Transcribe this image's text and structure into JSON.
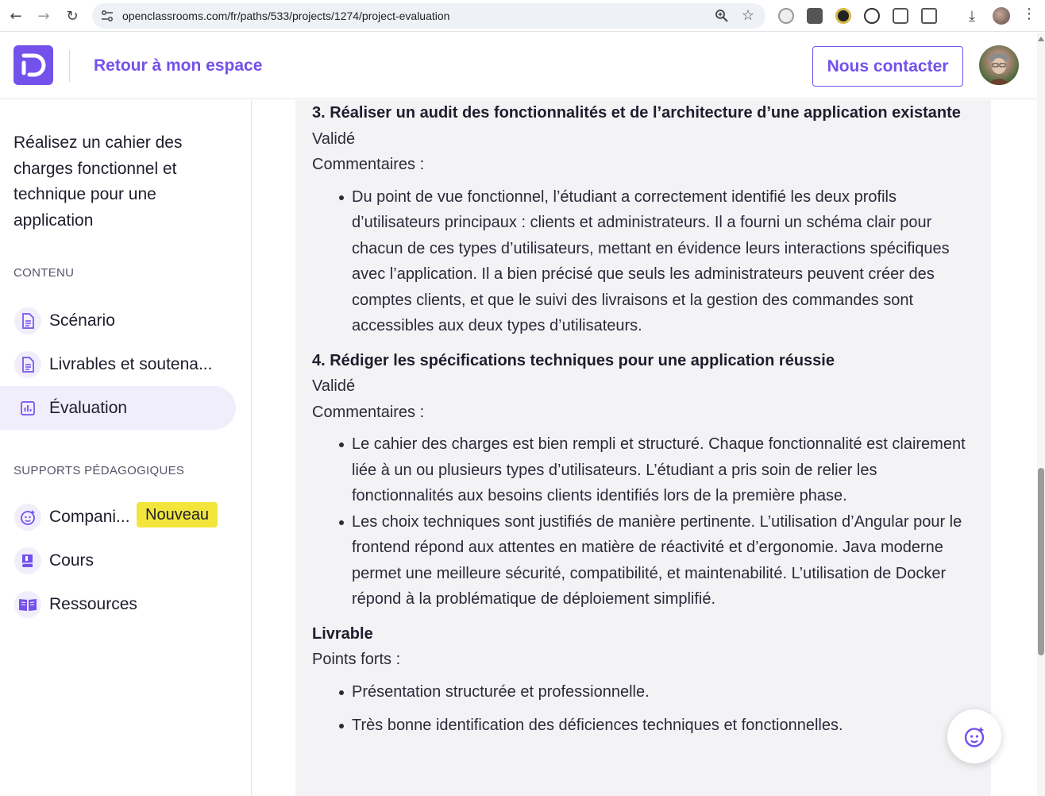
{
  "browser": {
    "url": "openclassrooms.com/fr/paths/533/projects/1274/project-evaluation"
  },
  "header": {
    "back_label": "Retour à mon espace",
    "contact_label": "Nous contacter"
  },
  "sidebar": {
    "title": "Réalisez un cahier des charges fonctionnel et technique pour une application",
    "content_heading": "CONTENU",
    "content_items": [
      {
        "label": "Scénario",
        "icon": "document-icon"
      },
      {
        "label": "Livrables et soutena...",
        "icon": "document-icon"
      },
      {
        "label": "Évaluation",
        "icon": "chart-icon",
        "active": true
      }
    ],
    "supports_heading": "SUPPORTS PÉDAGOGIQUES",
    "support_items": [
      {
        "label": "Compani...",
        "icon": "companion-icon",
        "badge": "Nouveau"
      },
      {
        "label": "Cours",
        "icon": "book-icon"
      },
      {
        "label": "Ressources",
        "icon": "open-book-icon"
      }
    ]
  },
  "evaluation": {
    "section3": {
      "title": "3. Réaliser un audit des fonctionnalités et de l’architecture d’une application existante",
      "status": "Validé",
      "comments_label": "Commentaires :",
      "bullets": [
        "Du point de vue fonctionnel, l’étudiant a correctement identifié les deux profils d’utilisateurs principaux : clients et administrateurs. Il a fourni un schéma clair pour chacun de ces types d’utilisateurs, mettant en évidence leurs interactions spécifiques avec l’application. Il a bien précisé que seuls les administrateurs peuvent créer des comptes clients, et que le suivi des livraisons et la gestion des commandes sont accessibles aux deux types d’utilisateurs."
      ]
    },
    "section4": {
      "title": "4. Rédiger les spécifications techniques pour une application réussie",
      "status": "Validé",
      "comments_label": "Commentaires :",
      "bullets": [
        "Le cahier des charges est bien rempli et structuré. Chaque fonctionnalité est clairement liée à un ou plusieurs types d’utilisateurs. L’étudiant a pris soin de relier les fonctionnalités aux besoins clients identifiés lors de la première phase.",
        "Les choix techniques sont justifiés de manière pertinente. L’utilisation d’Angular pour le frontend répond aux attentes en matière de réactivité et d’ergonomie. Java moderne permet une meilleure sécurité, compatibilité, et maintenabilité. L’utilisation de Docker répond à la problématique de déploiement simplifié."
      ]
    },
    "livrable": {
      "title": "Livrable",
      "strengths_label": "Points forts :",
      "bullets": [
        "Présentation structurée et professionnelle.",
        "Très bonne identification des déficiences techniques et fonctionnelles."
      ]
    }
  },
  "colors": {
    "brand": "#7451eb",
    "badge": "#f2e63d",
    "card_bg": "#f3f3f6"
  }
}
